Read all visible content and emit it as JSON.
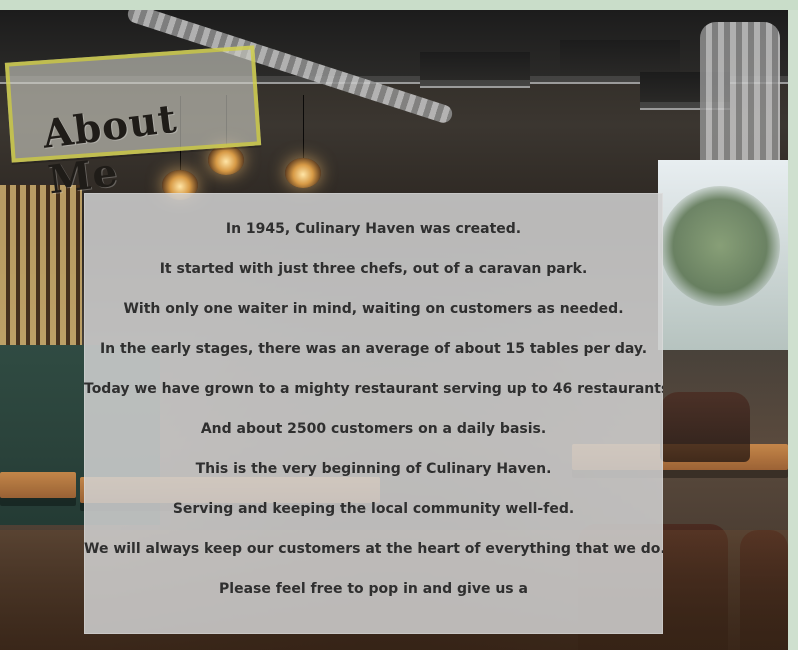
{
  "section": {
    "title": "About Me",
    "story_lines": [
      "In 1945, Culinary Haven was created.",
      "It started with just three chefs, out of a caravan park.",
      "With only one waiter in mind, waiting on customers as needed.",
      "In the early stages, there was an average of about 15 tables per day.",
      "Today we have grown to a mighty restaurant serving up to 46 restaurants.",
      "And about 2500 customers on a daily basis.",
      "This is the very beginning of Culinary Haven.",
      "Serving and keeping the local community well-fed.",
      "We will always keep our customers at the heart of everything that we do.",
      "Please feel free to pop in and give us a"
    ]
  },
  "colors": {
    "top_strip": "#c9ddc9",
    "title_border": "#d0cd3e",
    "story_panel": "#d2d2d2"
  }
}
